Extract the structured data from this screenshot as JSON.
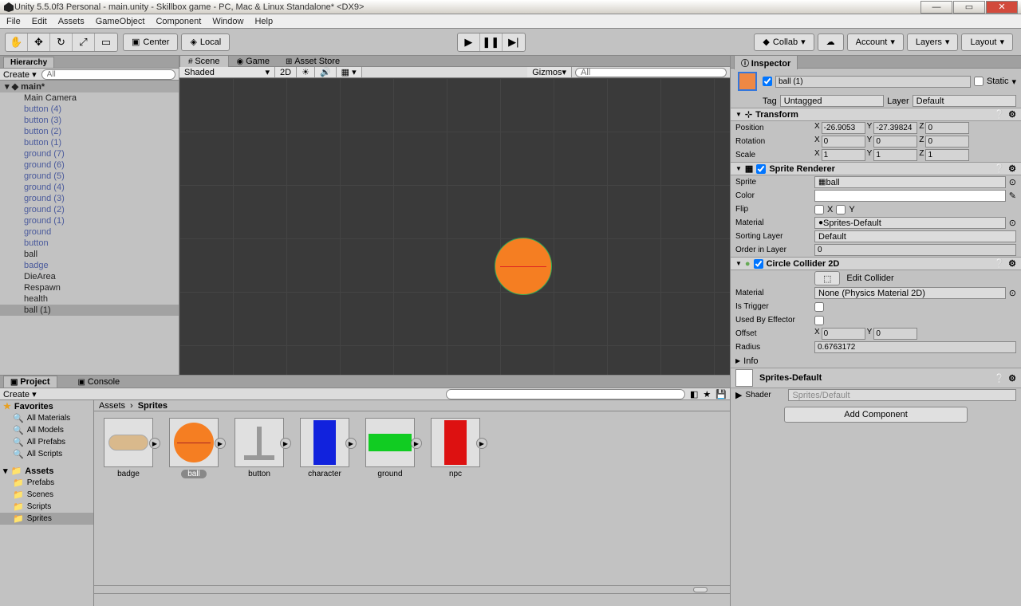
{
  "title": "Unity 5.5.0f3 Personal - main.unity - Skillbox game - PC, Mac & Linux Standalone* <DX9>",
  "menus": [
    "File",
    "Edit",
    "Assets",
    "GameObject",
    "Component",
    "Window",
    "Help"
  ],
  "toolbar": {
    "center": "Center",
    "local": "Local",
    "collab": "Collab",
    "account": "Account",
    "layers": "Layers",
    "layout": "Layout"
  },
  "hierarchy": {
    "tab": "Hierarchy",
    "create": "Create",
    "scene_name": "main*",
    "items": [
      {
        "name": "Main Camera",
        "blue": false
      },
      {
        "name": "button (4)",
        "blue": true
      },
      {
        "name": "button (3)",
        "blue": true
      },
      {
        "name": "button (2)",
        "blue": true
      },
      {
        "name": "button (1)",
        "blue": true
      },
      {
        "name": "ground (7)",
        "blue": true
      },
      {
        "name": "ground (6)",
        "blue": true
      },
      {
        "name": "ground (5)",
        "blue": true
      },
      {
        "name": "ground (4)",
        "blue": true
      },
      {
        "name": "ground (3)",
        "blue": true
      },
      {
        "name": "ground (2)",
        "blue": true
      },
      {
        "name": "ground (1)",
        "blue": true
      },
      {
        "name": "ground",
        "blue": true
      },
      {
        "name": "button",
        "blue": true
      },
      {
        "name": "ball",
        "blue": false
      },
      {
        "name": "badge",
        "blue": true
      },
      {
        "name": "DieArea",
        "blue": false
      },
      {
        "name": "Respawn",
        "blue": false
      },
      {
        "name": "health",
        "blue": false
      },
      {
        "name": "ball (1)",
        "blue": false,
        "selected": true
      }
    ]
  },
  "scene": {
    "tabs": [
      "Scene",
      "Game",
      "Asset Store"
    ],
    "shading": "Shaded",
    "mode2d": "2D",
    "gizmos": "Gizmos"
  },
  "inspector": {
    "tab": "Inspector",
    "object_name": "ball (1)",
    "static": "Static",
    "tag_label": "Tag",
    "tag": "Untagged",
    "layer_label": "Layer",
    "layer": "Default",
    "transform": {
      "title": "Transform",
      "position": {
        "label": "Position",
        "x": "-26.9053",
        "y": "-27.39824",
        "z": "0"
      },
      "rotation": {
        "label": "Rotation",
        "x": "0",
        "y": "0",
        "z": "0"
      },
      "scale": {
        "label": "Scale",
        "x": "1",
        "y": "1",
        "z": "1"
      }
    },
    "sprite_renderer": {
      "title": "Sprite Renderer",
      "sprite_label": "Sprite",
      "sprite": "ball",
      "color_label": "Color",
      "flip_label": "Flip",
      "flip_x": "X",
      "flip_y": "Y",
      "material_label": "Material",
      "material": "Sprites-Default",
      "sorting_label": "Sorting Layer",
      "sorting": "Default",
      "order_label": "Order in Layer",
      "order": "0"
    },
    "collider": {
      "title": "Circle Collider 2D",
      "edit": "Edit Collider",
      "material_label": "Material",
      "material": "None (Physics Material 2D)",
      "trigger_label": "Is Trigger",
      "effector_label": "Used By Effector",
      "offset_label": "Offset",
      "offset_x": "0",
      "offset_y": "0",
      "radius_label": "Radius",
      "radius": "0.6763172"
    },
    "info": "Info",
    "shader_section": {
      "title": "Sprites-Default",
      "shader_label": "Shader",
      "shader": "Sprites/Default"
    },
    "add_component": "Add Component"
  },
  "project": {
    "tab": "Project",
    "console": "Console",
    "create": "Create",
    "favorites": "Favorites",
    "fav_items": [
      "All Materials",
      "All Models",
      "All Prefabs",
      "All Scripts"
    ],
    "assets": "Assets",
    "asset_items": [
      "Prefabs",
      "Scenes",
      "Scripts",
      "Sprites"
    ],
    "breadcrumb": [
      "Assets",
      "Sprites"
    ],
    "thumbs": [
      {
        "name": "badge",
        "color": "#d9b98c",
        "shape": "badge"
      },
      {
        "name": "ball",
        "color": "#f57e22",
        "shape": "circle",
        "selected": true
      },
      {
        "name": "button",
        "color": "#999",
        "shape": "button"
      },
      {
        "name": "character",
        "color": "#1122dd",
        "shape": "rect-tall"
      },
      {
        "name": "ground",
        "color": "#11cc22",
        "shape": "rect-wide"
      },
      {
        "name": "npc",
        "color": "#dd1111",
        "shape": "rect-tall"
      }
    ]
  }
}
